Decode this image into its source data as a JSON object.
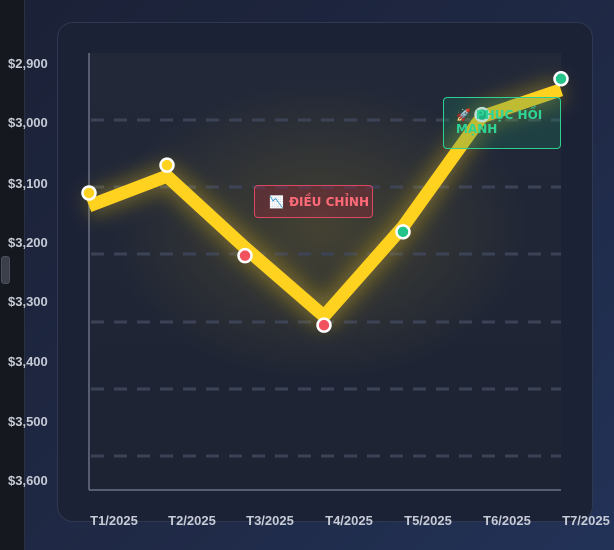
{
  "chart_data": {
    "type": "line",
    "categories": [
      "T1/2025",
      "T2/2025",
      "T3/2025",
      "T4/2025",
      "T5/2025",
      "T6/2025",
      "T7/2025"
    ],
    "series": [
      {
        "values": [
          3140,
          3090,
          3210,
          3325,
          3175,
          2990,
          2945
        ]
      }
    ],
    "y_axis": {
      "inverted": true,
      "range": [
        2885,
        3635
      ],
      "ticks": [
        2900,
        3000,
        3100,
        3200,
        3300,
        3400,
        3500,
        3600
      ],
      "tick_labels": [
        "$2,900",
        "$3,000",
        "$3,100",
        "$3,200",
        "$3,300",
        "$3,400",
        "$3,500",
        "$3,600"
      ]
    },
    "grid": "horizontal-dashed",
    "point_colors": [
      "#ffd21f",
      "#ffd21f",
      "#f0525e",
      "#f0525e",
      "#22c48a",
      "#22c48a",
      "#22c48a"
    ],
    "line_color": "#ffd21f",
    "annotations": [
      {
        "icon": "chart-decreasing-icon",
        "glyph": "📉",
        "text": "ĐIỀU CHỈNH",
        "color": "#ff6a78"
      },
      {
        "icon": "rocket-icon",
        "glyph": "🚀",
        "text": "PHỤC HỒI MẠNH",
        "color": "#2fd395"
      }
    ]
  }
}
